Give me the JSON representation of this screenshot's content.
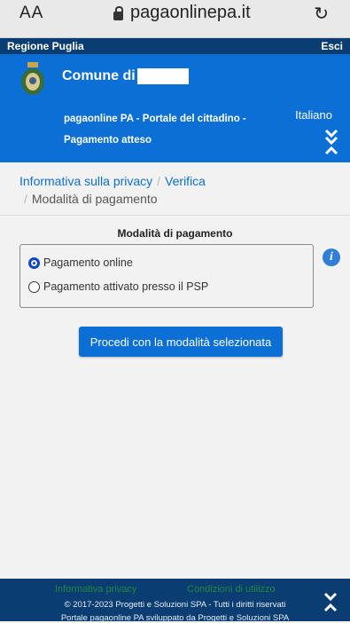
{
  "browser": {
    "text_size": "AA",
    "url": "pagaonlinepa.it"
  },
  "region_bar": {
    "region": "Regione Puglia",
    "logout": "Esci"
  },
  "header": {
    "comune": "Comune di",
    "portal_title": "pagaonline PA - Portale del cittadino -",
    "page_subtitle": "Pagamento atteso",
    "language": "Italiano"
  },
  "breadcrumb": {
    "item1": "Informativa sulla privacy",
    "item2": "Verifica",
    "current": "Modalità di pagamento",
    "separator": "/"
  },
  "payment": {
    "section_title": "Modalità di pagamento",
    "options": [
      {
        "label": "Pagamento online",
        "selected": true
      },
      {
        "label": "Pagamento attivato presso il PSP",
        "selected": false
      }
    ],
    "proceed_label": "Procedi con la modalità selezionata"
  },
  "footer": {
    "privacy_link": "Informativa privacy",
    "terms_link": "Condizioni di utilizzo",
    "copyright": "© 2017-2023 Progetti e Soluzioni SPA - Tutti i diritti riservati",
    "portal_credit": "Portale pagaonline PA sviluppato da Progetti e Soluzioni SPA"
  },
  "colors": {
    "header_blue": "#0b6fd6",
    "dark_navy": "#0a3d72",
    "link_blue": "#0b6fd6",
    "footer_link_green": "#1f8a3a"
  },
  "icons": [
    "lock-icon",
    "reload-icon",
    "crest-logo",
    "collapse-icon",
    "info-icon"
  ]
}
